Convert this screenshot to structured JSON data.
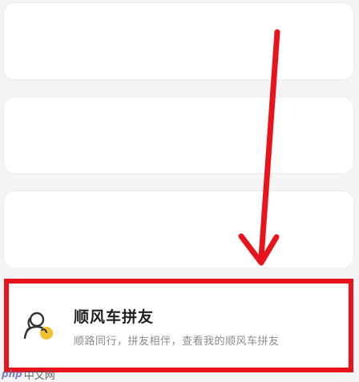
{
  "carpool": {
    "title": "顺风车拼友",
    "description": "顺路同行，拼友相伴，查看我的顺风车拼友",
    "icon": "people-icon"
  },
  "watermark": {
    "logo": "php",
    "text": "中文网"
  },
  "colors": {
    "highlight": "#e8131b",
    "icon_accent": "#f2c12e"
  }
}
